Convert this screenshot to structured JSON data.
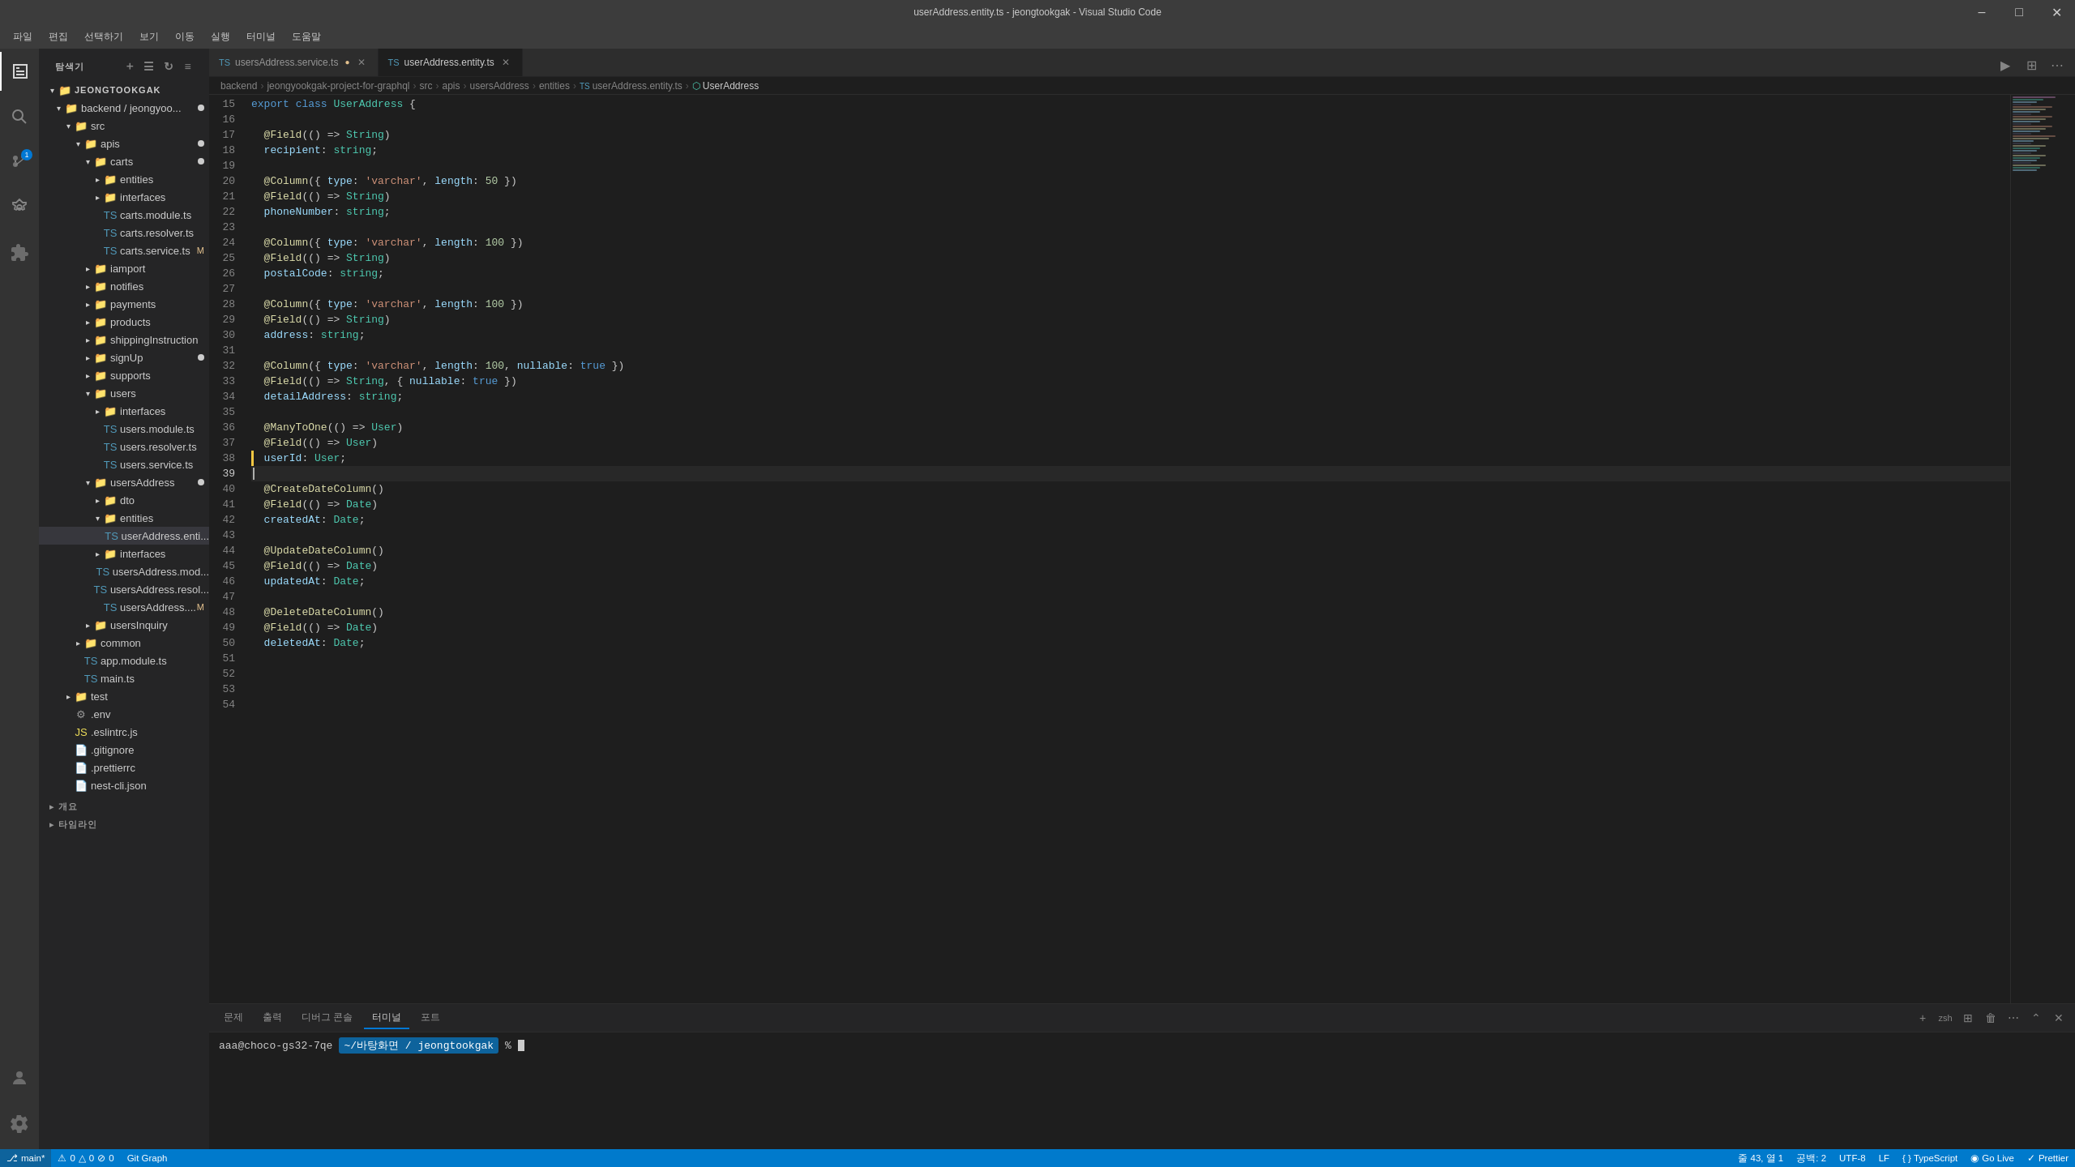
{
  "window": {
    "title": "userAddress.entity.ts - jeongtookgak - Visual Studio Code"
  },
  "menu": {
    "items": [
      "파일",
      "편집",
      "선택하기",
      "보기",
      "이동",
      "실행",
      "터미널",
      "도움말"
    ]
  },
  "sidebar": {
    "header": "탐색기",
    "root": "JEONGTOOKGAK",
    "tree": [
      {
        "id": "backend",
        "label": "backend / jeongyoo...",
        "type": "folder",
        "indent": 0,
        "open": true,
        "modified": true
      },
      {
        "id": "src",
        "label": "src",
        "type": "folder",
        "indent": 1,
        "open": true
      },
      {
        "id": "apis",
        "label": "apis",
        "type": "folder",
        "indent": 2,
        "open": true,
        "modified": true
      },
      {
        "id": "carts",
        "label": "carts",
        "type": "folder",
        "indent": 3,
        "open": true,
        "modified": true
      },
      {
        "id": "entities",
        "label": "entities",
        "type": "folder",
        "indent": 4,
        "open": false
      },
      {
        "id": "interfaces",
        "label": "interfaces",
        "type": "folder",
        "indent": 4,
        "open": false
      },
      {
        "id": "carts.module.ts",
        "label": "carts.module.ts",
        "type": "ts",
        "indent": 4
      },
      {
        "id": "carts.resolver.ts",
        "label": "carts.resolver.ts",
        "type": "ts",
        "indent": 4
      },
      {
        "id": "carts.service.ts",
        "label": "carts.service.ts",
        "type": "ts",
        "indent": 4,
        "modified": true
      },
      {
        "id": "iamport",
        "label": "iamport",
        "type": "folder",
        "indent": 3,
        "open": false
      },
      {
        "id": "notifies",
        "label": "notifies",
        "type": "folder",
        "indent": 3,
        "open": false
      },
      {
        "id": "payments",
        "label": "payments",
        "type": "folder",
        "indent": 3,
        "open": false
      },
      {
        "id": "products",
        "label": "products",
        "type": "folder",
        "indent": 3,
        "open": false
      },
      {
        "id": "shippingInstruction",
        "label": "shippingInstruction",
        "type": "folder",
        "indent": 3,
        "open": false
      },
      {
        "id": "signUp",
        "label": "signUp",
        "type": "folder",
        "indent": 3,
        "open": false,
        "modified": true
      },
      {
        "id": "supports",
        "label": "supports",
        "type": "folder",
        "indent": 3,
        "open": false
      },
      {
        "id": "users",
        "label": "users",
        "type": "folder",
        "indent": 3,
        "open": true
      },
      {
        "id": "users-interfaces",
        "label": "interfaces",
        "type": "folder",
        "indent": 4,
        "open": false
      },
      {
        "id": "users.module.ts",
        "label": "users.module.ts",
        "type": "ts",
        "indent": 4
      },
      {
        "id": "users.resolver.ts",
        "label": "users.resolver.ts",
        "type": "ts",
        "indent": 4
      },
      {
        "id": "users.service.ts",
        "label": "users.service.ts",
        "type": "ts",
        "indent": 4
      },
      {
        "id": "usersAddress",
        "label": "usersAddress",
        "type": "folder",
        "indent": 3,
        "open": true,
        "modified": true
      },
      {
        "id": "dto",
        "label": "dto",
        "type": "folder",
        "indent": 4,
        "open": false
      },
      {
        "id": "ua-entities",
        "label": "entities",
        "type": "folder",
        "indent": 4,
        "open": true
      },
      {
        "id": "userAddress.entity.ts",
        "label": "userAddress.enti...",
        "type": "ts",
        "indent": 5,
        "active": true
      },
      {
        "id": "ua-interfaces",
        "label": "interfaces",
        "type": "folder",
        "indent": 4,
        "open": false
      },
      {
        "id": "usersAddress.mod",
        "label": "usersAddress.mod...",
        "type": "ts",
        "indent": 4
      },
      {
        "id": "usersAddress.resol",
        "label": "usersAddress.resol...",
        "type": "ts",
        "indent": 4
      },
      {
        "id": "usersAddress2",
        "label": "usersAddress....",
        "type": "ts",
        "indent": 4,
        "modified": true
      },
      {
        "id": "usersInquiry",
        "label": "usersInquiry",
        "type": "folder",
        "indent": 3,
        "open": false
      },
      {
        "id": "common",
        "label": "common",
        "type": "folder",
        "indent": 2,
        "open": false
      },
      {
        "id": "app.module.ts",
        "label": "app.module.ts",
        "type": "ts",
        "indent": 2
      },
      {
        "id": "main.ts",
        "label": "main.ts",
        "type": "ts",
        "indent": 2
      },
      {
        "id": "test",
        "label": "test",
        "type": "folder",
        "indent": 1,
        "open": false
      },
      {
        "id": ".env",
        "label": ".env",
        "type": "file",
        "indent": 1
      },
      {
        "id": ".eslintrc.js",
        "label": ".eslintrc.js",
        "type": "js",
        "indent": 1
      },
      {
        "id": ".gitignore",
        "label": ".gitignore",
        "type": "file",
        "indent": 1
      },
      {
        "id": ".prettierrc",
        "label": ".prettierrc",
        "type": "file",
        "indent": 1
      },
      {
        "id": "nest-cli.json",
        "label": "nest-cli.json",
        "type": "file",
        "indent": 1
      }
    ]
  },
  "tabs": [
    {
      "id": "usersAddress.service.ts",
      "label": "usersAddress.service.ts",
      "active": false,
      "modified": true
    },
    {
      "id": "userAddress.entity.ts",
      "label": "userAddress.entity.ts",
      "active": true,
      "modified": false
    }
  ],
  "breadcrumb": {
    "items": [
      "backend",
      "jeongyookgak-project-for-graphql",
      "src",
      "apis",
      "usersAddress",
      "entities",
      "userAddress.entity.ts",
      "UserAddress"
    ]
  },
  "editor": {
    "lines": [
      {
        "num": 15,
        "content": "export class UserAddress {"
      },
      {
        "num": 16,
        "content": ""
      },
      {
        "num": 17,
        "content": "  @Field(() => String)"
      },
      {
        "num": 18,
        "content": "  recipient: string;"
      },
      {
        "num": 19,
        "content": ""
      },
      {
        "num": 20,
        "content": "  @Column({ type: 'varchar', length: 50 })"
      },
      {
        "num": 21,
        "content": "  @Field(() => String)"
      },
      {
        "num": 22,
        "content": "  phoneNumber: string;"
      },
      {
        "num": 23,
        "content": ""
      },
      {
        "num": 24,
        "content": "  @Column({ type: 'varchar', length: 100 })"
      },
      {
        "num": 25,
        "content": "  @Field(() => String)"
      },
      {
        "num": 26,
        "content": "  postalCode: string;"
      },
      {
        "num": 27,
        "content": ""
      },
      {
        "num": 28,
        "content": "  @Column({ type: 'varchar', length: 100 })"
      },
      {
        "num": 29,
        "content": "  @Field(() => String)"
      },
      {
        "num": 30,
        "content": "  address: string;"
      },
      {
        "num": 31,
        "content": ""
      },
      {
        "num": 32,
        "content": "  @Column({ type: 'varchar', length: 100, nullable: true })"
      },
      {
        "num": 33,
        "content": "  @Field(() => String, { nullable: true })"
      },
      {
        "num": 34,
        "content": "  detailAddress: string;"
      },
      {
        "num": 35,
        "content": ""
      },
      {
        "num": 36,
        "content": "  @ManyToOne(() => User)"
      },
      {
        "num": 37,
        "content": "  @Field(() => User)"
      },
      {
        "num": 38,
        "content": "  userId: User;"
      },
      {
        "num": 39,
        "content": ""
      },
      {
        "num": 40,
        "content": "  @CreateDateColumn()"
      },
      {
        "num": 41,
        "content": "  @Field(() => Date)"
      },
      {
        "num": 42,
        "content": "  createdAt: Date;"
      },
      {
        "num": 43,
        "content": ""
      },
      {
        "num": 44,
        "content": "  @UpdateDateColumn()"
      },
      {
        "num": 45,
        "content": "  @Field(() => Date)"
      },
      {
        "num": 46,
        "content": "  updatedAt: Date;"
      },
      {
        "num": 47,
        "content": ""
      },
      {
        "num": 48,
        "content": "  @DeleteDateColumn()"
      },
      {
        "num": 49,
        "content": "  @Field(() => Date)"
      },
      {
        "num": 50,
        "content": "  deletedAt: Date;"
      }
    ]
  },
  "panel": {
    "tabs": [
      "문제",
      "출력",
      "디버그 콘솔",
      "터미널",
      "포트"
    ],
    "active_tab": "터미널",
    "terminal": {
      "user": "aaa@choco-gs32-7qe",
      "path": "~/바탕화면 / jeongtookgak"
    }
  },
  "statusbar": {
    "branch": "⎇ main*",
    "errors": "⚠ 0 △ 0 ⊘ 0",
    "position": "줄 43, 열 1",
    "spaces": "공백: 2",
    "encoding": "UTF-8",
    "eol": "LF",
    "language": "TypeScript",
    "go_live": "Go Live",
    "prettier": "Prettier"
  }
}
